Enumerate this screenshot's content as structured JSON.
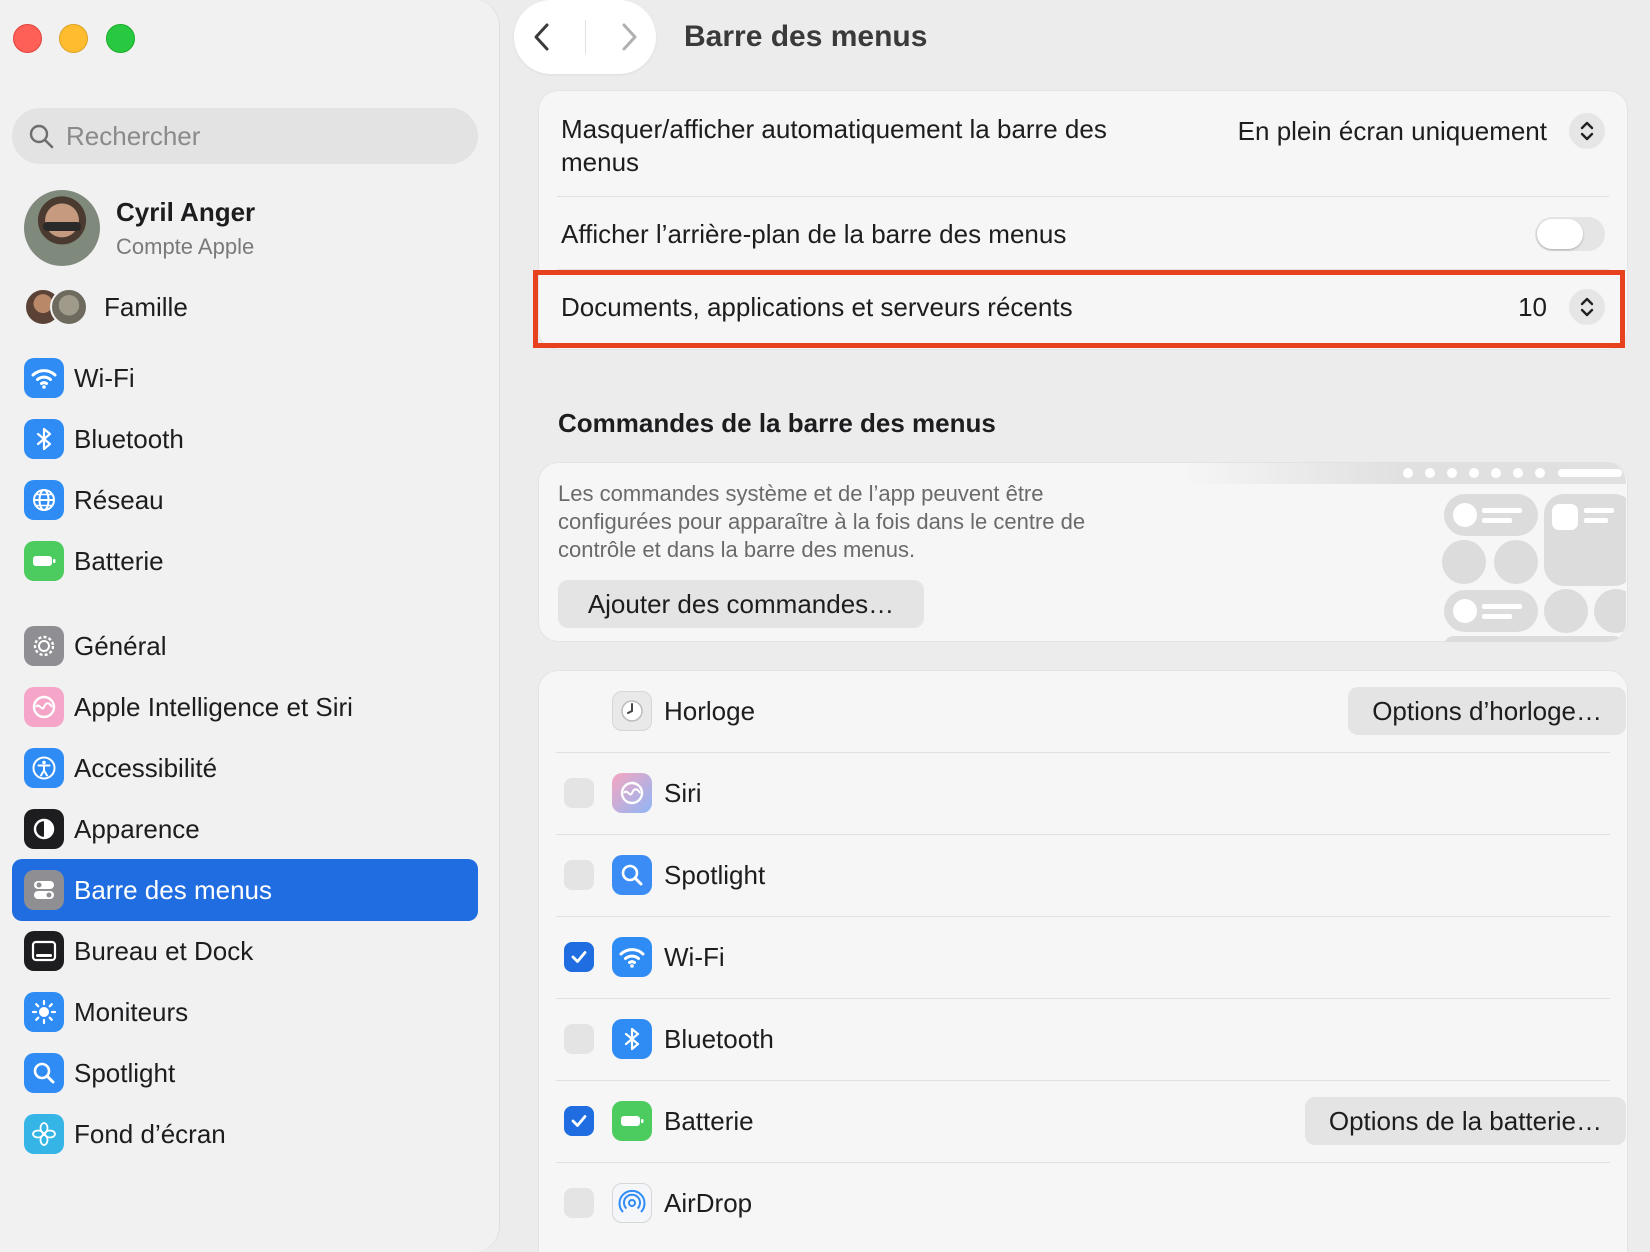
{
  "window": {
    "title": "Barre des menus"
  },
  "search": {
    "placeholder": "Rechercher"
  },
  "profile": {
    "name": "Cyril Anger",
    "subtitle": "Compte Apple"
  },
  "family": {
    "label": "Famille"
  },
  "sidebar": {
    "items": [
      {
        "label": "Wi-Fi",
        "icon": "wifi-icon",
        "color": "#2f8cf5"
      },
      {
        "label": "Bluetooth",
        "icon": "bluetooth-icon",
        "color": "#2f8cf5"
      },
      {
        "label": "Réseau",
        "icon": "globe-icon",
        "color": "#2f8cf5"
      },
      {
        "label": "Batterie",
        "icon": "battery-icon",
        "color": "#4ccb5f"
      },
      {
        "label": "Général",
        "icon": "gear-icon",
        "color": "#8e8e93"
      },
      {
        "label": "Apple Intelligence et Siri",
        "icon": "siri-icon",
        "color": "#f5a6c8"
      },
      {
        "label": "Accessibilité",
        "icon": "accessibility-icon",
        "color": "#2f8cf5"
      },
      {
        "label": "Apparence",
        "icon": "appearance-icon",
        "color": "#1d1d1f"
      },
      {
        "label": "Barre des menus",
        "icon": "menubar-icon",
        "color": "#8e8e93",
        "active": true
      },
      {
        "label": "Bureau et Dock",
        "icon": "dock-icon",
        "color": "#1d1d1f"
      },
      {
        "label": "Moniteurs",
        "icon": "display-icon",
        "color": "#2f8cf5"
      },
      {
        "label": "Spotlight",
        "icon": "spotlight-icon",
        "color": "#2f8cf5"
      },
      {
        "label": "Fond d’écran",
        "icon": "wallpaper-icon",
        "color": "#34b5e5"
      }
    ]
  },
  "settings": {
    "autohide": {
      "label": "Masquer/afficher automatiquement la barre des menus",
      "value": "En plein écran uniquement"
    },
    "background": {
      "label": "Afficher l’arrière-plan de la barre des menus",
      "enabled": false
    },
    "recents": {
      "label": "Documents, applications et serveurs récents",
      "value": "10"
    }
  },
  "controls": {
    "title": "Commandes de la barre des menus",
    "description": "Les commandes système et de l’app peuvent être configurées pour apparaître à la fois dans le centre de contrôle et dans la barre des menus.",
    "add_button": "Ajouter des commandes…",
    "items": [
      {
        "label": "Horloge",
        "icon": "clock-icon",
        "checkbox": null,
        "button": "Options d’horloge…"
      },
      {
        "label": "Siri",
        "icon": "siri-icon",
        "checkbox": false,
        "button": null
      },
      {
        "label": "Spotlight",
        "icon": "spotlight-icon",
        "checkbox": false,
        "button": null
      },
      {
        "label": "Wi-Fi",
        "icon": "wifi-icon",
        "checkbox": true,
        "button": null
      },
      {
        "label": "Bluetooth",
        "icon": "bluetooth-icon",
        "checkbox": false,
        "button": null
      },
      {
        "label": "Batterie",
        "icon": "battery-icon",
        "checkbox": true,
        "button": "Options de la batterie…"
      },
      {
        "label": "AirDrop",
        "icon": "airdrop-icon",
        "checkbox": false,
        "button": null
      }
    ]
  },
  "colors": {
    "accent": "#1f6de0",
    "highlight": "#e8411e"
  }
}
